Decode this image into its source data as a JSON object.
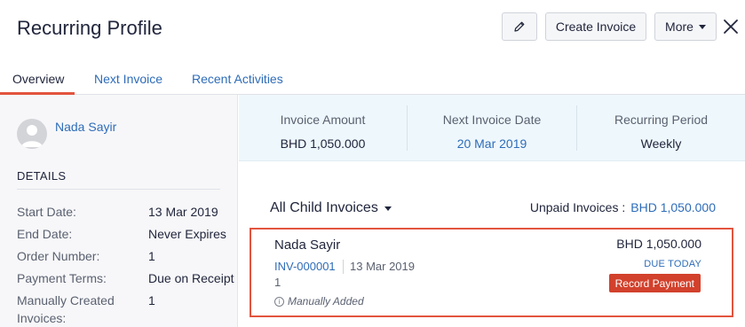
{
  "header": {
    "title": "Recurring Profile",
    "create_invoice_label": "Create Invoice",
    "more_label": "More"
  },
  "tabs": [
    {
      "label": "Overview",
      "active": true
    },
    {
      "label": "Next Invoice",
      "active": false
    },
    {
      "label": "Recent Activities",
      "active": false
    }
  ],
  "sidebar": {
    "contact_name": "Nada Sayir",
    "details_title": "DETAILS",
    "details": [
      {
        "label": "Start Date:",
        "value": "13 Mar 2019"
      },
      {
        "label": "End Date:",
        "value": "Never Expires"
      },
      {
        "label": "Order Number:",
        "value": "1"
      },
      {
        "label": "Payment Terms:",
        "value": "Due on Receipt"
      },
      {
        "label": "Manually Created",
        "label2": "Invoices:",
        "value": "1"
      }
    ]
  },
  "summary": {
    "invoice_amount_label": "Invoice Amount",
    "invoice_amount_value": "BHD 1,050.000",
    "next_invoice_date_label": "Next Invoice Date",
    "next_invoice_date_value": "20 Mar 2019",
    "recurring_period_label": "Recurring Period",
    "recurring_period_value": "Weekly"
  },
  "child_invoices": {
    "filter_label": "All Child Invoices",
    "unpaid_label": "Unpaid Invoices :",
    "unpaid_amount": "BHD 1,050.000",
    "invoice": {
      "customer": "Nada Sayir",
      "number": "INV-000001",
      "date": "13 Mar 2019",
      "count": "1",
      "note": "Manually Added",
      "amount": "BHD 1,050.000",
      "status": "DUE TODAY",
      "action_label": "Record Payment"
    }
  },
  "colors": {
    "accent": "#e2543e",
    "link": "#2e6cb8",
    "record_button": "#d2412c",
    "summary_bg": "#eef7fc"
  },
  "icons": {
    "edit": "pencil-icon",
    "close": "close-icon",
    "dropdown": "chevron-down-icon",
    "avatar": "user-avatar-icon",
    "info": "info-icon"
  }
}
